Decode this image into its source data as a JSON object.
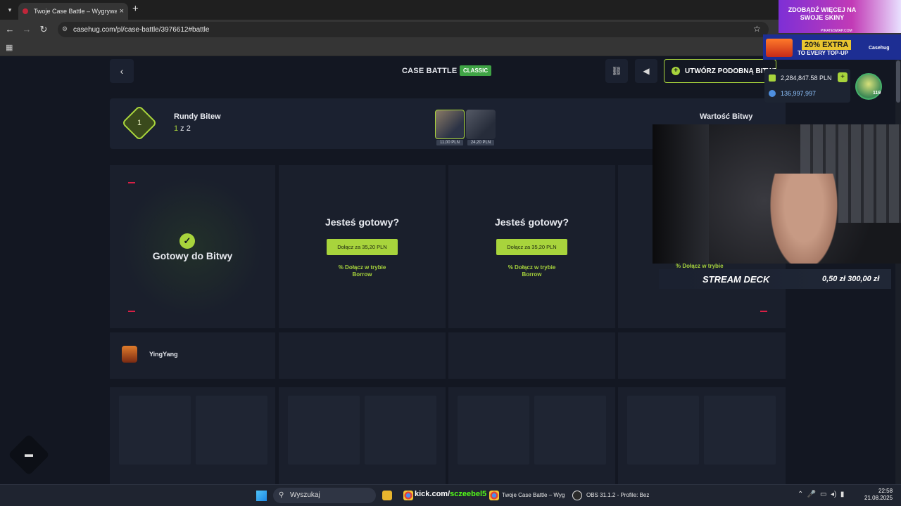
{
  "browser": {
    "tab_title": "Twoje Case Battle – Wygrywaj",
    "tab_close": "×",
    "new_tab": "+",
    "url": "casehug.com/pl/case-battle/3976612#battle"
  },
  "header": {
    "title": "CASE BATTLE",
    "mode_badge": "CLASSIC",
    "create_label": "UTWÓRZ PODOBNĄ BITWĘ"
  },
  "user": {
    "balance": "2,284,847.58 PLN",
    "coins": "136,997,997",
    "level": "119"
  },
  "ad": {
    "headline": "ZDOBĄDŹ WIĘCEJ NA SWOJE SKINY",
    "site": "PIRATESWAP.COM",
    "extra": "20% EXTRA",
    "topup": "TO EVERY TOP-UP",
    "brand": "Casehug"
  },
  "rounds": {
    "number": "1",
    "label": "Rundy Bitew",
    "current": "1",
    "of": " z 2",
    "battle_value_label": "Wartość Bitwy",
    "cases": [
      {
        "price": "11,00 PLN"
      },
      {
        "price": "24,20 PLN"
      }
    ]
  },
  "arena": {
    "ready_text": "Gotowy do Bitwy",
    "ask_text": "Jesteś gotowy?",
    "join_label": "Dołącz za 35,20 PLN",
    "borrow_line1": "% Dołącz w trybie",
    "borrow_line2": "Borrow"
  },
  "players": [
    {
      "name": "YingYang"
    }
  ],
  "streamdeck": {
    "title": "STREAM DECK",
    "values": "0,50 zł  300,00 zł"
  },
  "taskbar": {
    "search_placeholder": "Wyszukaj",
    "kick_prefix": "kick.com/",
    "kick_user": "sczeebel5",
    "chrome_title": "Twoje Case Battle – Wyg",
    "obs_title": "OBS 31.1.2 - Profile: Bez",
    "time": "22:58",
    "date": "21.08.2025"
  },
  "colors": {
    "accent_green": "#a8d43c",
    "badge_green": "#3fa445",
    "red_marker": "#d81f45",
    "page_bg": "#131722",
    "panel_bg": "#1b2130"
  }
}
